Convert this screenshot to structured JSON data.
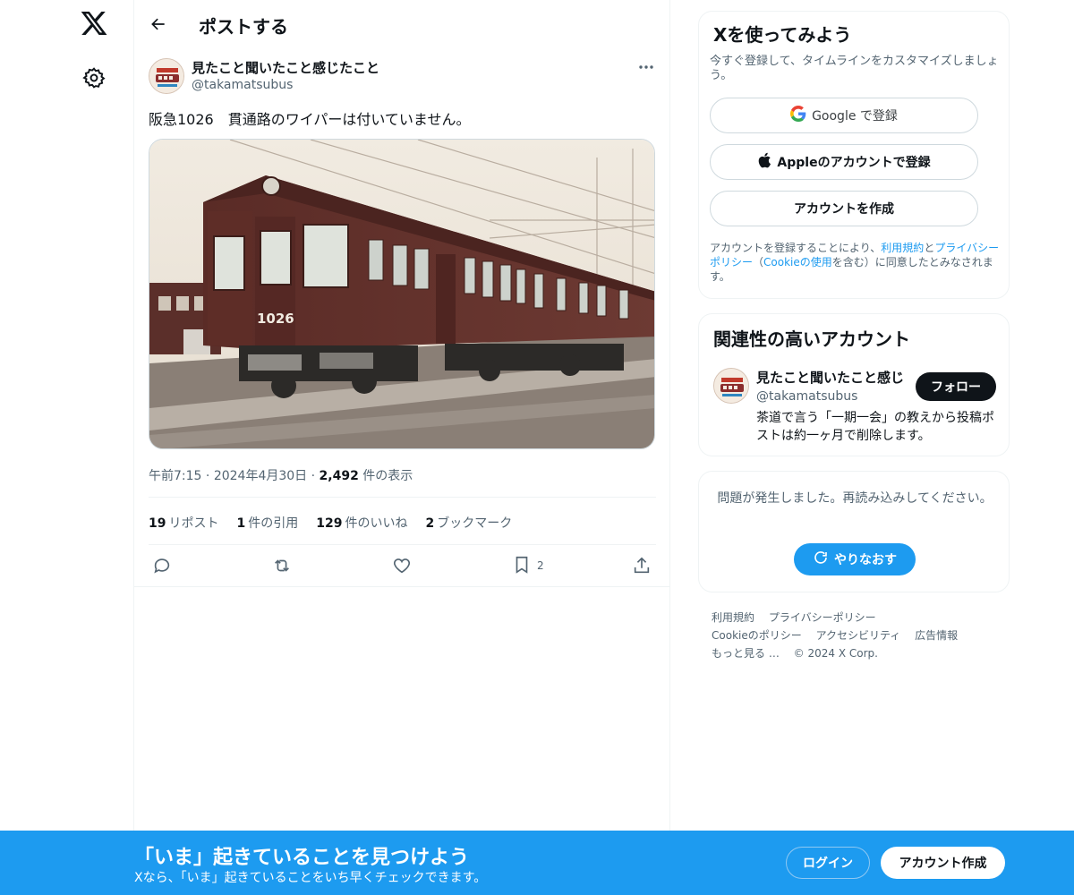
{
  "header": {
    "title": "ポストする"
  },
  "post": {
    "author_name": "見たこと聞いたこと感じたこと",
    "author_handle": "@takamatsubus",
    "text": "阪急1026　貫通路のワイパーは付いていません。",
    "train_number": "1026",
    "time": "午前7:15",
    "date": "2024年4月30日",
    "views_count": "2,492",
    "views_label": "件の表示",
    "stats": [
      {
        "count": "19",
        "label": "リポスト"
      },
      {
        "count": "1",
        "label": "件の引用"
      },
      {
        "count": "129",
        "label": "件のいいね"
      },
      {
        "count": "2",
        "label": "ブックマーク"
      }
    ],
    "bookmark_count": "2"
  },
  "signup": {
    "title": "Xを使ってみよう",
    "subtitle": "今すぐ登録して、タイムラインをカスタマイズしましょう。",
    "google_label": "Google で登録",
    "apple_label": "Appleのアカウントで登録",
    "create_label": "アカウントを作成",
    "legal_prefix": "アカウントを登録することにより、",
    "legal_terms": "利用規約",
    "legal_and": "と",
    "legal_privacy": "プライバシーポリシー",
    "legal_paren_open": "（",
    "legal_cookie": "Cookieの使用",
    "legal_suffix": "を含む）に同意したとみなされます。"
  },
  "related": {
    "title": "関連性の高いアカウント",
    "name": "見たこと聞いたこと感じ",
    "handle": "@takamatsubus",
    "bio": "茶道で言う「一期一会」の教えから投稿ポストは約一ヶ月で削除します。",
    "follow_label": "フォロー"
  },
  "error": {
    "message": "問題が発生しました。再読み込みしてください。",
    "retry_label": "やりなおす"
  },
  "footer": {
    "links": [
      "利用規約",
      "プライバシーポリシー",
      "Cookieのポリシー",
      "アクセシビリティ",
      "広告情報",
      "もっと見る …"
    ],
    "copyright": "© 2024 X Corp."
  },
  "banner": {
    "title": "「いま」起きていることを見つけよう",
    "subtitle": "Xなら、「いま」起きていることをいち早くチェックできます。",
    "login_label": "ログイン",
    "create_label": "アカウント作成"
  },
  "colors": {
    "accent": "#1d9bf0",
    "text": "#0f1419",
    "secondary": "#536471"
  }
}
